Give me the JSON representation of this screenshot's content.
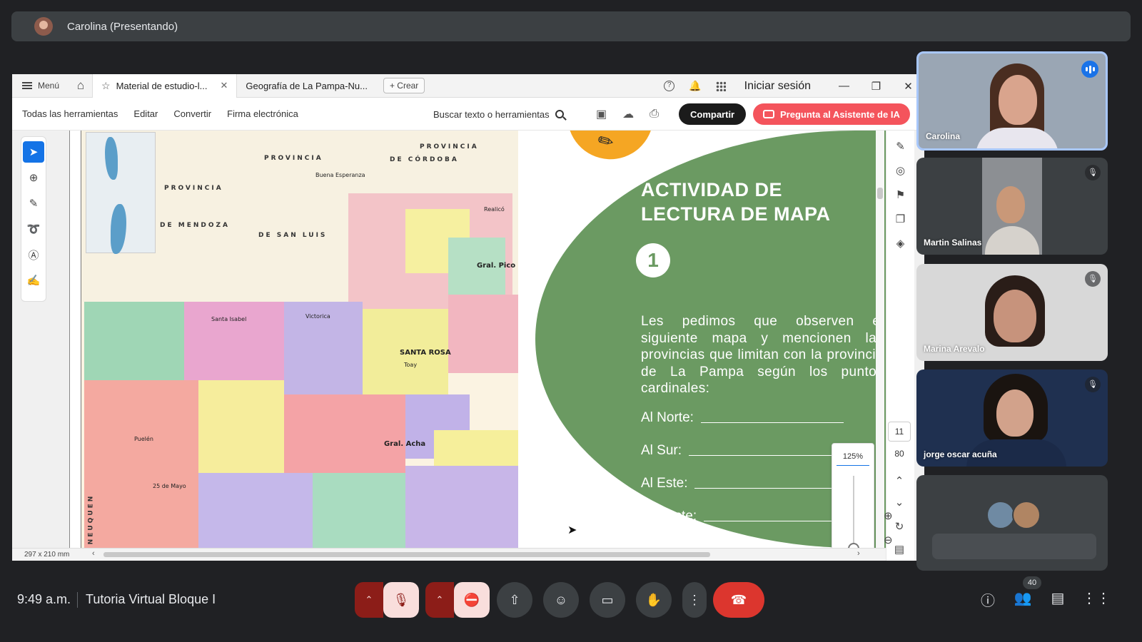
{
  "presenter": {
    "label": "Carolina (Presentando)"
  },
  "browser": {
    "menu_label": "Menú",
    "tabs": [
      {
        "label": "Material de estudio-l..."
      },
      {
        "label": "Geografía de La Pampa-Nu..."
      }
    ],
    "create_label": "+ Crear",
    "signin_label": "Iniciar sesión"
  },
  "toolbar": {
    "menu_items": [
      "Todas las herramientas",
      "Editar",
      "Convertir",
      "Firma electrónica"
    ],
    "search_label": "Buscar texto o herramientas",
    "share_label": "Compartir",
    "ai_label": "Pregunta al Asistente de IA"
  },
  "map": {
    "labels": {
      "provincia_cordoba_1": "PROVINCIA",
      "provincia_cordoba_2": "DE CÓRDOBA",
      "provincia_top": "PROVINCIA",
      "provincia_left": "PROVINCIA",
      "de_mendoza": "DE MENDOZA",
      "de_san_luis": "DE SAN LUIS",
      "neuquen": "NEUQUEN"
    },
    "cities": {
      "santa_rosa": "SANTA ROSA",
      "toay": "Toay",
      "gral_pico": "Gral. Pico",
      "gral_acha": "Gral. Acha",
      "santa_isabel": "Santa Isabel",
      "victorica": "Victorica",
      "buena_esperanza": "Buena Esperanza",
      "puelen": "Puelén",
      "veinticinco_mayo": "25 de Mayo",
      "realico": "Realicó"
    }
  },
  "activity": {
    "title_line1": "ACTIVIDAD DE",
    "title_line2": "LECTURA DE MAPA",
    "number": "1",
    "instructions": "Les pedimos que observen el siguiente mapa y mencionen las provincias que limitan con la provincia de La Pampa según los puntos cardinales:",
    "answers": [
      "Al Norte:",
      "Al Sur:",
      "Al Este:",
      "Al Oeste:"
    ]
  },
  "viewer": {
    "page_current": "11",
    "page_total": "80",
    "zoom": "125%",
    "page_size": "297 x 210 mm"
  },
  "participants": [
    {
      "name": "Carolina",
      "status": "speaking"
    },
    {
      "name": "Martin Salinas",
      "status": "muted"
    },
    {
      "name": "Marina Arevalo",
      "status": "muted"
    },
    {
      "name": "jorge oscar acuña",
      "status": "muted"
    }
  ],
  "meeting": {
    "time": "9:49 a.m.",
    "title": "Tutoria Virtual Bloque I",
    "people_count": "40"
  },
  "colors": {
    "green_panel": "#6b9a62",
    "accent_blue": "#1473e6",
    "ai_button": "#f4545c",
    "hangup": "#dc362e"
  }
}
